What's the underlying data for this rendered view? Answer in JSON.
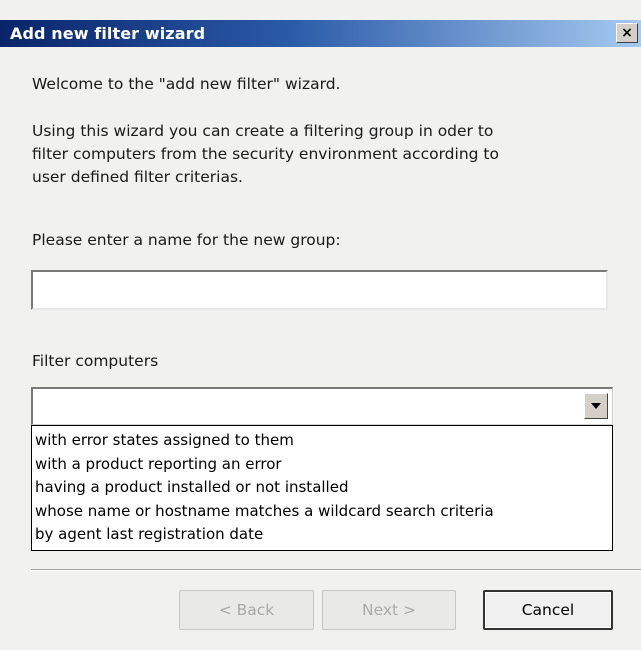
{
  "window": {
    "title": "Add new filter wizard",
    "close_label": "×"
  },
  "content": {
    "welcome": "Welcome to the \"add new filter\" wizard.",
    "intro_line1": "Using this wizard you can create a filtering group in oder to",
    "intro_line2": "filter computers from the security environment according to",
    "intro_line3": "user defined filter criterias.",
    "name_label": "Please enter a name for the new group:",
    "name_value": "",
    "filter_label": "Filter computers",
    "filter_selected": ""
  },
  "dropdown": {
    "options": [
      "with error states assigned to them",
      "with a product reporting an error",
      "having a product installed or not installed",
      "whose name or hostname matches a wildcard search criteria",
      "by agent last registration date"
    ]
  },
  "buttons": {
    "back": "< Back",
    "next": "Next >",
    "cancel": "Cancel"
  },
  "icons": {
    "close": "close-icon",
    "dropdown": "chevron-down-icon"
  }
}
